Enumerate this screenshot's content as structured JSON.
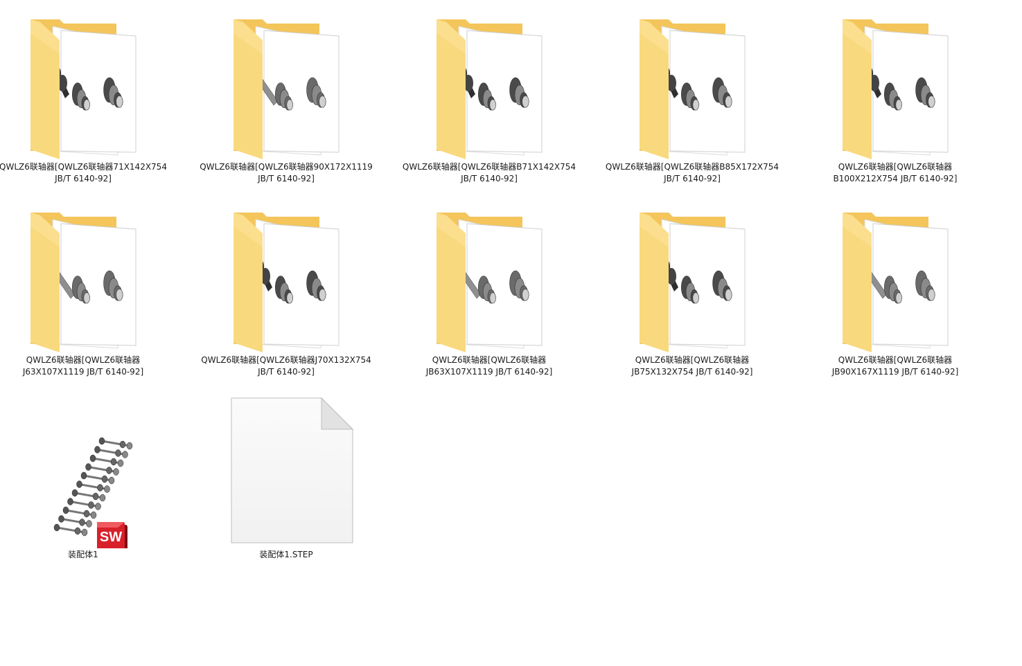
{
  "folders": [
    {
      "line1": "QWLZ6联轴器[QWLZ6联轴器71X142X754",
      "line2": "JB∕T 6140-92]",
      "variant": "dark"
    },
    {
      "line1": "QWLZ6联轴器[QWLZ6联轴器90X172X1119",
      "line2": "JB∕T 6140-92]",
      "variant": "long"
    },
    {
      "line1": "QWLZ6联轴器[QWLZ6联轴器B71X142X754",
      "line2": "JB∕T 6140-92]",
      "variant": "dark"
    },
    {
      "line1": "QWLZ6联轴器[QWLZ6联轴器B85X172X754",
      "line2": "JB∕T 6140-92]",
      "variant": "dark"
    },
    {
      "line1": "QWLZ6联轴器[QWLZ6联轴器",
      "line2": "B100X212X754 JB∕T 6140-92]",
      "variant": "dark"
    },
    {
      "line1": "QWLZ6联轴器[QWLZ6联轴器",
      "line2": "J63X107X1119 JB∕T 6140-92]",
      "variant": "long"
    },
    {
      "line1": "QWLZ6联轴器[QWLZ6联轴器J70X132X754",
      "line2": "JB∕T 6140-92]",
      "variant": "dark"
    },
    {
      "line1": "QWLZ6联轴器[QWLZ6联轴器",
      "line2": "JB63X107X1119 JB∕T 6140-92]",
      "variant": "long"
    },
    {
      "line1": "QWLZ6联轴器[QWLZ6联轴器",
      "line2": "JB75X132X754 JB∕T 6140-92]",
      "variant": "dark"
    },
    {
      "line1": "QWLZ6联轴器[QWLZ6联轴器",
      "line2": "JB90X167X1119 JB∕T 6140-92]",
      "variant": "long"
    }
  ],
  "files": {
    "assembly": {
      "name": "装配体1",
      "badge": "SW",
      "icon": "solidworks-assembly-icon"
    },
    "step": {
      "name": "装配体1.STEP",
      "icon": "blank-document-icon"
    }
  },
  "colors": {
    "folder_back": "#f3c55b",
    "folder_front": "#f9d97e",
    "paper": "#ffffff",
    "part_dark": "#555555",
    "part_light": "#9a9a9a",
    "sw_red": "#d8202a"
  }
}
